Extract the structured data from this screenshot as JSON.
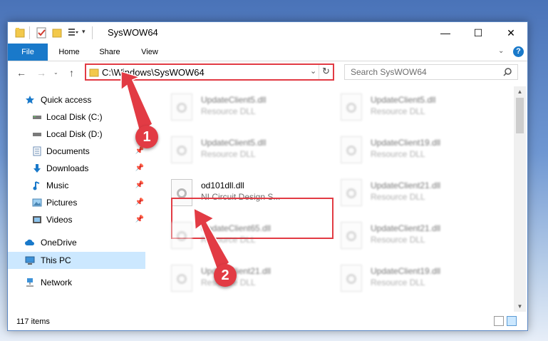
{
  "window": {
    "title": "SysWOW64",
    "controls": [
      "—",
      "☐",
      "✕"
    ]
  },
  "ribbon": {
    "tabs": [
      "File",
      "Home",
      "Share",
      "View"
    ]
  },
  "nav": {
    "address": "C:\\Windows\\SysWOW64",
    "search_placeholder": "Search SysWOW64"
  },
  "sidebar": {
    "items": [
      {
        "label": "Quick access",
        "icon": "star-icon"
      },
      {
        "label": "Local Disk (C:)",
        "icon": "drive-icon"
      },
      {
        "label": "Local Disk (D:)",
        "icon": "drive-icon"
      },
      {
        "label": "Documents",
        "icon": "documents-icon"
      },
      {
        "label": "Downloads",
        "icon": "downloads-icon"
      },
      {
        "label": "Music",
        "icon": "music-icon"
      },
      {
        "label": "Pictures",
        "icon": "pictures-icon"
      },
      {
        "label": "Videos",
        "icon": "videos-icon"
      },
      {
        "label": "OneDrive",
        "icon": "cloud-icon"
      },
      {
        "label": "This PC",
        "icon": "computer-icon"
      },
      {
        "label": "Network",
        "icon": "network-icon"
      }
    ]
  },
  "files": [
    {
      "name": "UpdateClient5.dll",
      "desc": "Resource DLL"
    },
    {
      "name": "UpdateClient5.dll",
      "desc": "Resource DLL"
    },
    {
      "name": "UpdateClient5.dll",
      "desc": "Resource DLL"
    },
    {
      "name": "UpdateClient19.dll",
      "desc": "Resource DLL"
    },
    {
      "name": "od101dll.dll",
      "desc": "NI Circuit Design S..."
    },
    {
      "name": "UpdateClient21.dll",
      "desc": "Resource DLL"
    },
    {
      "name": "UpdateClient65.dll",
      "desc": "Resource DLL"
    },
    {
      "name": "UpdateClient21.dll",
      "desc": "Resource DLL"
    },
    {
      "name": "UpdateClient21.dll",
      "desc": "Resource DLL"
    },
    {
      "name": "UpdateClient19.dll",
      "desc": "Resource DLL"
    }
  ],
  "status": {
    "count": "117 items"
  },
  "annotations": {
    "step1": "1",
    "step2": "2"
  },
  "colors": {
    "accent": "#1979ca",
    "annotation": "#e23b44",
    "selection": "#cce8ff"
  }
}
